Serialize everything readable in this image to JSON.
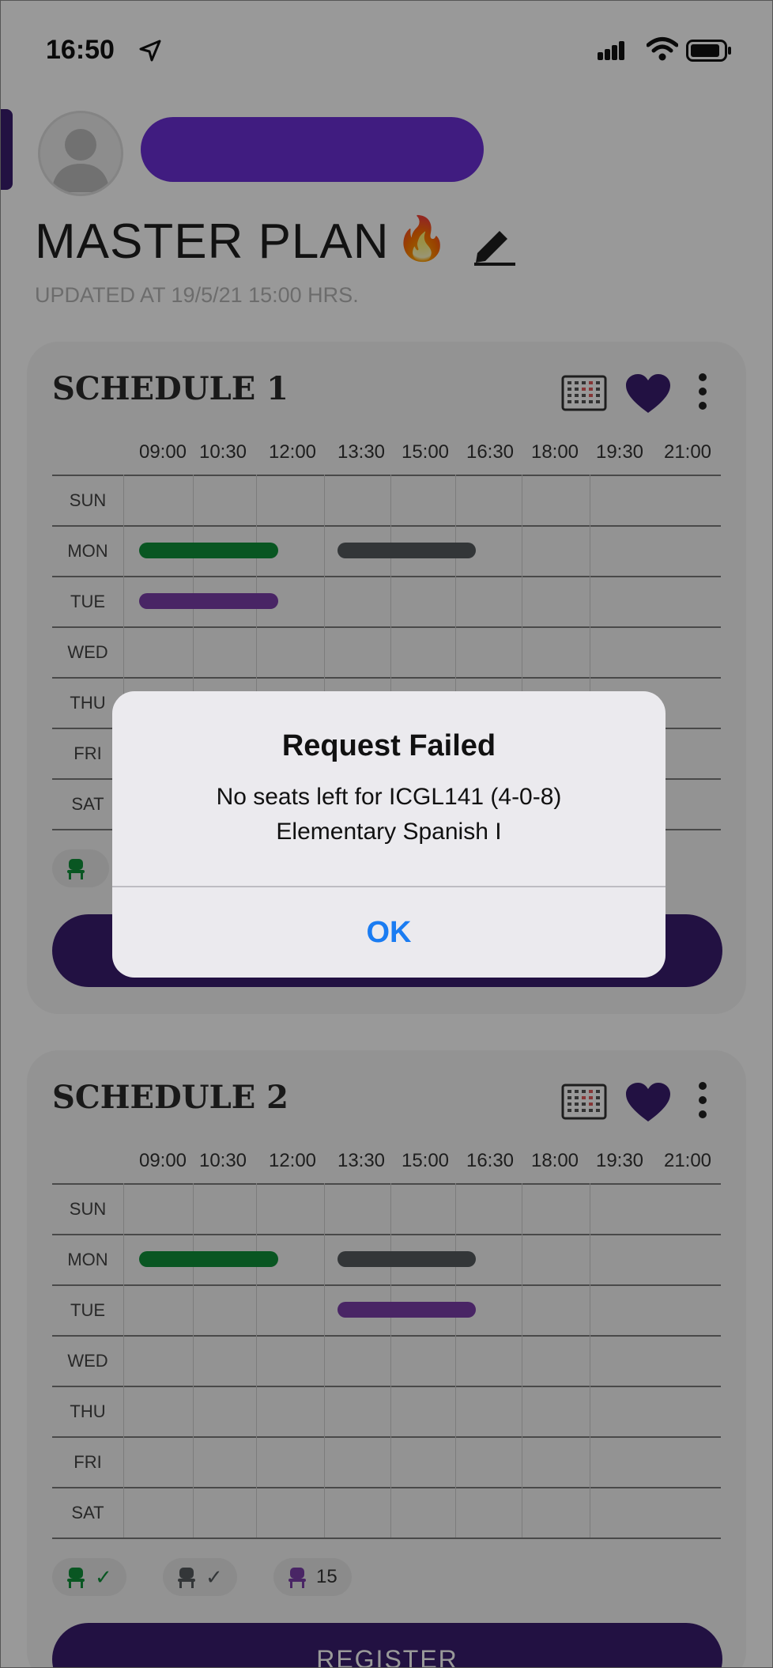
{
  "status_bar": {
    "time": "16:50"
  },
  "profile": {
    "page_title": "MASTER PLAN",
    "title_emoji": "🔥",
    "updated_text": "UPDATED AT 19/5/21 15:00 HRS."
  },
  "time_labels": [
    "09:00",
    "10:30",
    "12:00",
    "13:30",
    "15:00",
    "16:30",
    "18:00",
    "19:30",
    "21:00"
  ],
  "days": [
    "SUN",
    "MON",
    "TUE",
    "WED",
    "THU",
    "FRI",
    "SAT"
  ],
  "colors": {
    "accent": "#3a1d6e",
    "bar_green": "#0f8f3a",
    "bar_gray": "#555a5e",
    "bar_purple": "#7a3ea8",
    "alert_button": "#1a7cf2"
  },
  "schedules": [
    {
      "title": "SCHEDULE 1",
      "blocks": [
        {
          "day": "MON",
          "start": "09:00",
          "end": "12:00",
          "color": "green"
        },
        {
          "day": "MON",
          "start": "13:30",
          "end": "16:30",
          "color": "gray"
        },
        {
          "day": "TUE",
          "start": "09:00",
          "end": "12:00",
          "color": "purple"
        }
      ],
      "chips": [
        {
          "icon": "seat-green-icon",
          "text": ""
        }
      ],
      "register_label": ""
    },
    {
      "title": "SCHEDULE 2",
      "blocks": [
        {
          "day": "MON",
          "start": "09:00",
          "end": "12:00",
          "color": "green"
        },
        {
          "day": "MON",
          "start": "13:30",
          "end": "16:30",
          "color": "gray"
        },
        {
          "day": "TUE",
          "start": "13:30",
          "end": "16:30",
          "color": "purple"
        }
      ],
      "chips": [
        {
          "icon": "seat-green-icon",
          "text": "✓"
        },
        {
          "icon": "seat-gray-icon",
          "text": "✓"
        },
        {
          "icon": "seat-purple-icon",
          "text": "15"
        }
      ],
      "register_label": "REGISTER"
    }
  ],
  "alert": {
    "title": "Request Failed",
    "message_line1": "No seats left for ICGL141 (4-0-8)",
    "message_line2": "Elementary Spanish I",
    "ok_label": "OK"
  }
}
